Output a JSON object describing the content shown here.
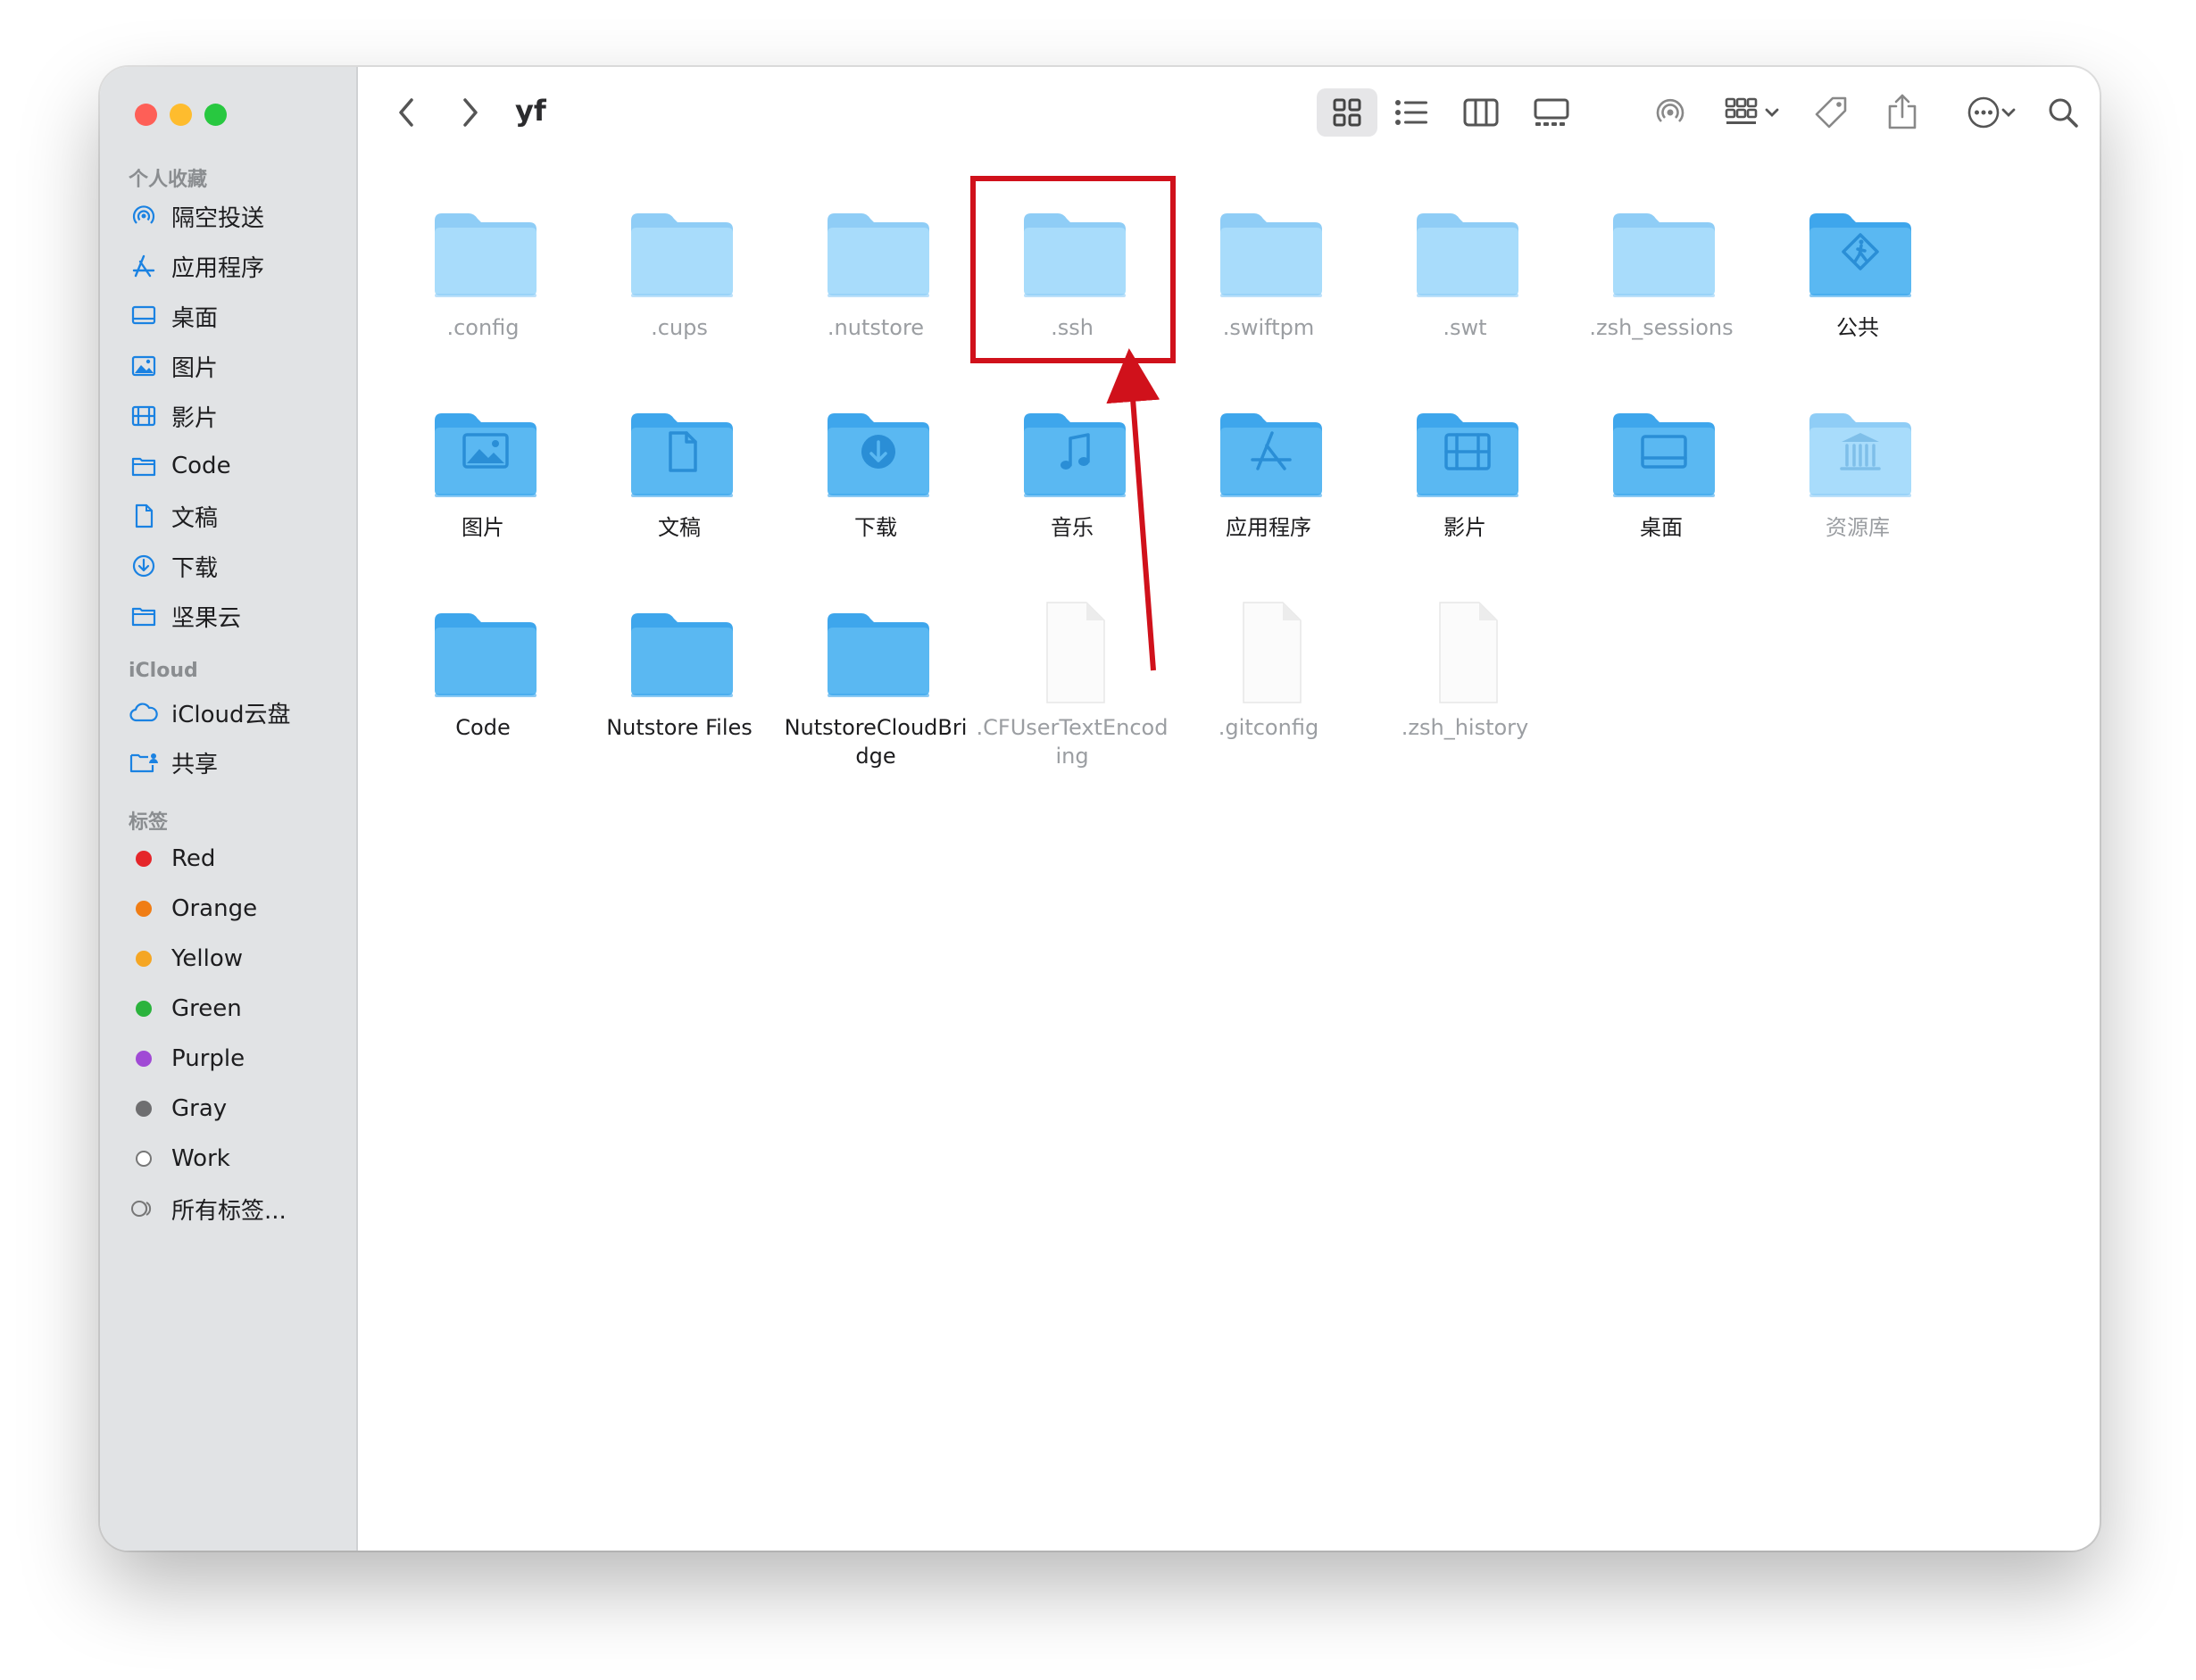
{
  "window": {
    "path_title": "yf"
  },
  "sidebar": {
    "favorites_title": "个人收藏",
    "favorites": [
      {
        "label": "隔空投送",
        "icon": "airdrop-icon"
      },
      {
        "label": "应用程序",
        "icon": "applications-icon"
      },
      {
        "label": "桌面",
        "icon": "desktop-icon"
      },
      {
        "label": "图片",
        "icon": "pictures-icon"
      },
      {
        "label": "影片",
        "icon": "movies-icon"
      },
      {
        "label": "Code",
        "icon": "folder-icon"
      },
      {
        "label": "文稿",
        "icon": "document-icon"
      },
      {
        "label": "下载",
        "icon": "download-icon"
      },
      {
        "label": "坚果云",
        "icon": "folder-icon"
      }
    ],
    "icloud_title": "iCloud",
    "icloud": [
      {
        "label": "iCloud云盘",
        "icon": "cloud-icon"
      },
      {
        "label": "共享",
        "icon": "shared-folder-icon"
      }
    ],
    "tags_title": "标签",
    "tags": [
      {
        "label": "Red",
        "color": "#e5262a"
      },
      {
        "label": "Orange",
        "color": "#f07d15"
      },
      {
        "label": "Yellow",
        "color": "#f5a623"
      },
      {
        "label": "Green",
        "color": "#2bb33d"
      },
      {
        "label": "Purple",
        "color": "#a04ad5"
      },
      {
        "label": "Gray",
        "color": "#6e6e70"
      },
      {
        "label": "Work",
        "color": ""
      },
      {
        "label": "所有标签...",
        "color": ""
      }
    ]
  },
  "files": [
    {
      "name": ".config",
      "kind": "folder",
      "hidden": true
    },
    {
      "name": ".cups",
      "kind": "folder",
      "hidden": true
    },
    {
      "name": ".nutstore",
      "kind": "folder",
      "hidden": true
    },
    {
      "name": ".ssh",
      "kind": "folder",
      "hidden": true
    },
    {
      "name": ".swiftpm",
      "kind": "folder",
      "hidden": true
    },
    {
      "name": ".swt",
      "kind": "folder",
      "hidden": true
    },
    {
      "name": ".zsh_sessions",
      "kind": "folder",
      "hidden": true
    },
    {
      "name": "公共",
      "kind": "public-folder",
      "hidden": false
    },
    {
      "name": "图片",
      "kind": "pictures-folder",
      "hidden": false
    },
    {
      "name": "文稿",
      "kind": "documents-folder",
      "hidden": false
    },
    {
      "name": "下载",
      "kind": "downloads-folder",
      "hidden": false
    },
    {
      "name": "音乐",
      "kind": "music-folder",
      "hidden": false
    },
    {
      "name": "应用程序",
      "kind": "applications-folder",
      "hidden": false
    },
    {
      "name": "影片",
      "kind": "movies-folder",
      "hidden": false
    },
    {
      "name": "桌面",
      "kind": "desktop-folder",
      "hidden": false
    },
    {
      "name": "资源库",
      "kind": "library-folder",
      "hidden": true
    },
    {
      "name": "Code",
      "kind": "folder-blue",
      "hidden": false
    },
    {
      "name": "Nutstore Files",
      "kind": "folder-blue",
      "hidden": false
    },
    {
      "name": "NutstoreCloudBridge",
      "kind": "folder-blue",
      "hidden": false
    },
    {
      "name": ".CFUserTextEncoding",
      "kind": "file",
      "hidden": true
    },
    {
      "name": ".gitconfig",
      "kind": "file",
      "hidden": true
    },
    {
      "name": ".zsh_history",
      "kind": "file",
      "hidden": true
    }
  ],
  "colors": {
    "annotation": "#d0111b",
    "folder_light": "#a8dcfb",
    "folder_blue": "#5ab8f2"
  }
}
